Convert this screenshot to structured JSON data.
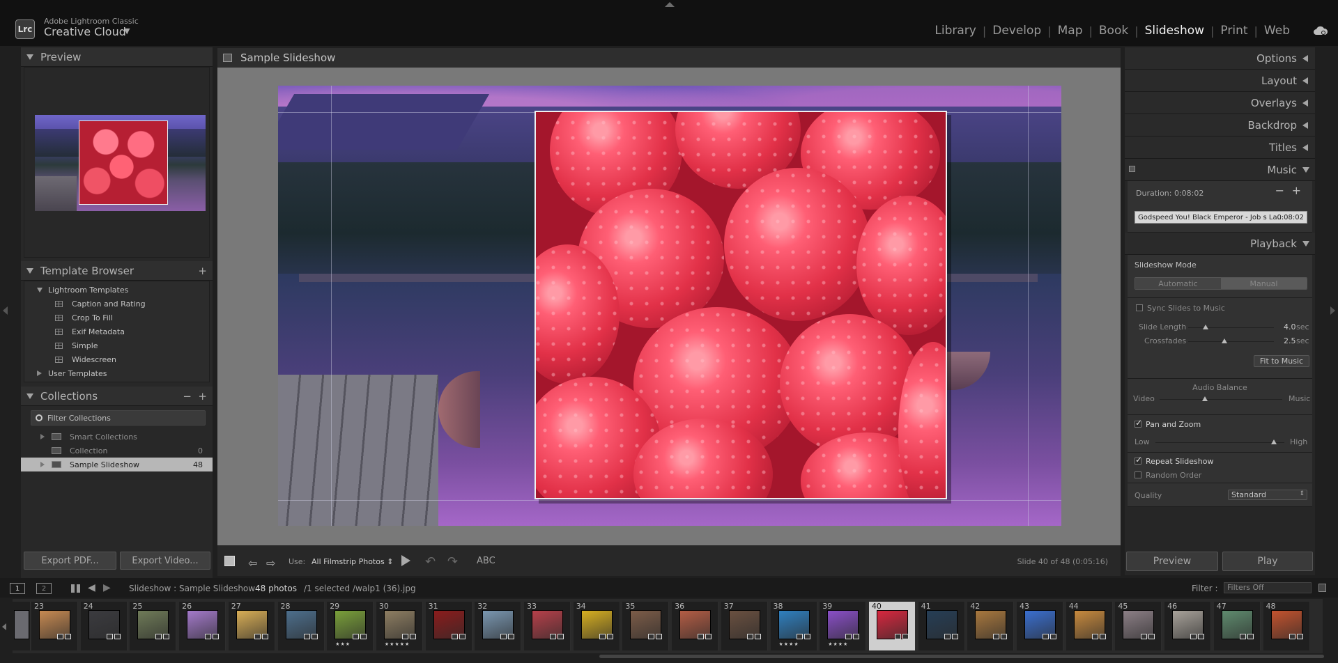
{
  "app": {
    "logo": "Lrc",
    "brand_small": "Adobe Lightroom Classic",
    "brand_large": "Creative Cloud",
    "brand_caret": "▼"
  },
  "modules": [
    {
      "label": "Library",
      "active": false
    },
    {
      "label": "Develop",
      "active": false
    },
    {
      "label": "Map",
      "active": false
    },
    {
      "label": "Book",
      "active": false
    },
    {
      "label": "Slideshow",
      "active": true
    },
    {
      "label": "Print",
      "active": false
    },
    {
      "label": "Web",
      "active": false
    }
  ],
  "left": {
    "preview_title": "Preview",
    "template_title": "Template Browser",
    "template_add": "+",
    "lightroom_templates": "Lightroom Templates",
    "templates": [
      "Caption and Rating",
      "Crop To Fill",
      "Exif Metadata",
      "Simple",
      "Widescreen"
    ],
    "user_templates": "User Templates",
    "collections_title": "Collections",
    "collections_minus": "−",
    "collections_plus": "+",
    "filter": "Filter Collections",
    "collections": [
      {
        "name": "Smart Collections",
        "count": ""
      },
      {
        "name": "Collection",
        "count": "0"
      },
      {
        "name": "Sample Slideshow",
        "count": "48"
      }
    ],
    "export_pdf": "Export PDF...",
    "export_video": "Export Video..."
  },
  "center": {
    "title": "Sample Slideshow",
    "use_label": "Use:",
    "use_value": "All Filmstrip Photos ⇕",
    "abc": "ABC",
    "status": "Slide 40 of 48 (0:05:16)"
  },
  "right": {
    "sections": [
      "Options",
      "Layout",
      "Overlays",
      "Backdrop",
      "Titles"
    ],
    "music_title": "Music",
    "duration": "Duration: 0:08:02",
    "track_name": "Godspeed You! Black Emperor - Job s La...",
    "track_time": "0:08:02",
    "playback_title": "Playback",
    "slideshow_mode": "Slideshow Mode",
    "mode_automatic": "Automatic",
    "mode_manual": "Manual",
    "sync_slides": "Sync Slides to Music",
    "slide_length_label": "Slide Length",
    "slide_length_value": "4.0",
    "slide_length_fraction": 0.2,
    "crossfades_label": "Crossfades",
    "crossfades_value": "2.5",
    "crossfades_fraction": 0.42,
    "sec": "sec",
    "fit_to_music": "Fit to Music",
    "audio_balance": "Audio Balance",
    "video": "Video",
    "music": "Music",
    "audio_balance_fraction": 0.37,
    "pan_zoom": "Pan and Zoom",
    "low": "Low",
    "high": "High",
    "pan_zoom_fraction": 0.92,
    "repeat": "Repeat Slideshow",
    "random": "Random Order",
    "quality_label": "Quality",
    "quality_value": "Standard",
    "preview_btn": "Preview",
    "play_btn": "Play"
  },
  "filmbar": {
    "screen1": "1",
    "screen2": "2",
    "path": "Slideshow : Sample Slideshow",
    "photos": "48 photos",
    "selection": "/1 selected /walp1 (36).jpg",
    "filter_label": "Filter :",
    "filter_value": "Filters Off"
  },
  "filmstrip": [
    {
      "n": "23",
      "stars": "",
      "color": "#c78a52"
    },
    {
      "n": "24",
      "stars": "",
      "color": "#3b3b3f"
    },
    {
      "n": "25",
      "stars": "",
      "color": "#6f7b58"
    },
    {
      "n": "26",
      "stars": "",
      "color": "#a47acb"
    },
    {
      "n": "27",
      "stars": "",
      "color": "#d9ae56"
    },
    {
      "n": "28",
      "stars": "",
      "color": "#4d6f8d"
    },
    {
      "n": "29",
      "stars": "★★★",
      "color": "#7aa03a"
    },
    {
      "n": "30",
      "stars": "★★★★★",
      "color": "#8e7e62"
    },
    {
      "n": "31",
      "stars": "",
      "color": "#8b1c1c"
    },
    {
      "n": "32",
      "stars": "",
      "color": "#7a97b1"
    },
    {
      "n": "33",
      "stars": "",
      "color": "#b6404a"
    },
    {
      "n": "34",
      "stars": "",
      "color": "#d8b021"
    },
    {
      "n": "35",
      "stars": "",
      "color": "#7c5c48"
    },
    {
      "n": "36",
      "stars": "",
      "color": "#b45d45"
    },
    {
      "n": "37",
      "stars": "",
      "color": "#6a5040"
    },
    {
      "n": "38",
      "stars": "★★★★",
      "color": "#2f80c0"
    },
    {
      "n": "39",
      "stars": "★★★★",
      "color": "#8a4fc8"
    },
    {
      "n": "40",
      "stars": "",
      "color": "#d8283f"
    },
    {
      "n": "41",
      "stars": "",
      "color": "#263e56"
    },
    {
      "n": "42",
      "stars": "",
      "color": "#a9783e"
    },
    {
      "n": "43",
      "stars": "",
      "color": "#3a6fd0"
    },
    {
      "n": "44",
      "stars": "",
      "color": "#c88a3e"
    },
    {
      "n": "45",
      "stars": "",
      "color": "#8c7f86"
    },
    {
      "n": "46",
      "stars": "",
      "color": "#a8a29a"
    },
    {
      "n": "47",
      "stars": "",
      "color": "#5f8b6e"
    },
    {
      "n": "48",
      "stars": "",
      "color": "#c4532e"
    }
  ],
  "filmstrip_selected": "40"
}
